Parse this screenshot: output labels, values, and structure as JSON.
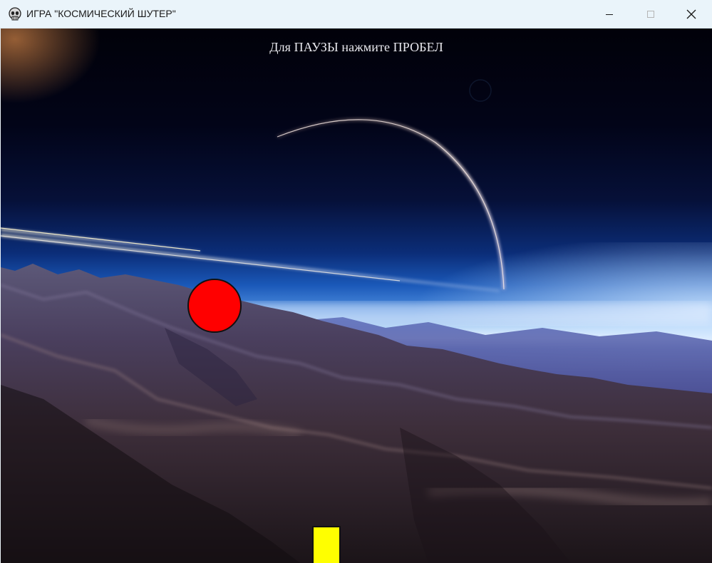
{
  "window": {
    "title": "ИГРА \"КОСМИЧЕСКИЙ ШУТЕР\"",
    "app_icon": "skull-icon",
    "controls": {
      "minimize_icon": "minimize-icon",
      "maximize_icon": "maximize-icon",
      "close_icon": "close-icon"
    }
  },
  "game": {
    "pause_hint": "Для ПАУЗЫ нажмите ПРОБЕЛ",
    "background": "space-planet-landscape",
    "enemy": {
      "shape": "circle",
      "color": "#ff0000"
    },
    "player": {
      "shape": "rectangle",
      "color": "#ffff00"
    }
  }
}
